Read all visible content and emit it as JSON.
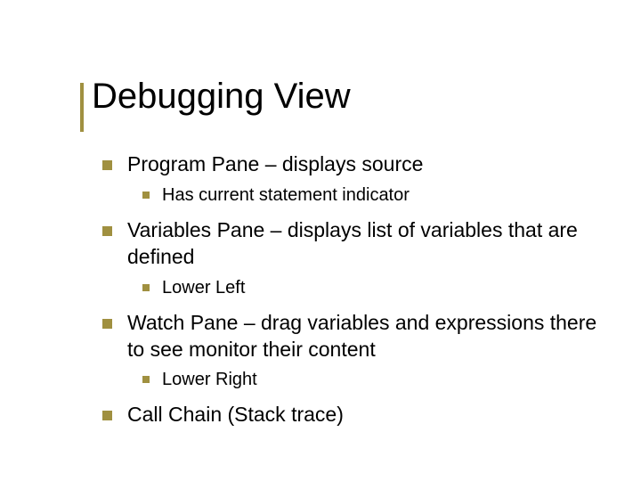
{
  "title": "Debugging View",
  "bullets": {
    "item0": {
      "text": "Program Pane – displays source",
      "sub0": "Has current statement indicator"
    },
    "item1": {
      "text": "Variables Pane – displays list of variables that are defined",
      "sub0": "Lower Left"
    },
    "item2": {
      "text": "Watch Pane – drag variables and expressions there to see monitor their content",
      "sub0": "Lower Right"
    },
    "item3": {
      "text": "Call Chain (Stack trace)"
    }
  }
}
